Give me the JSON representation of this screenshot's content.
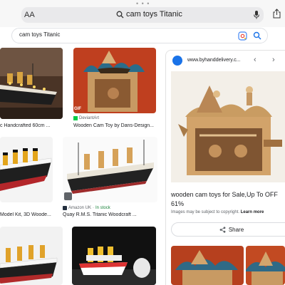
{
  "browser": {
    "aa_label": "AA",
    "address_text": "cam toys Titanic"
  },
  "search": {
    "query": "cam toys Titanic"
  },
  "results": [
    {
      "caption": "c Handcrafted 60cm ..."
    },
    {
      "caption": "Wooden Cam Toy by Dans-Design...",
      "source": "DeviantArt",
      "badge": "GIF"
    },
    {
      "caption": "Model Kit, 3D Woode..."
    },
    {
      "caption": "Quay R.M.S. Titanic Woodcraft ...",
      "source": "Amazon UK",
      "stock": "In stock"
    }
  ],
  "panel": {
    "site_url": "www.byhanddelivery.c...",
    "title": "wooden cam toys for Sale,Up To OFF 61%",
    "note": "Images may be subject to copyright.",
    "learn_more": "Learn more",
    "share_label": "Share"
  },
  "colors": {
    "link_blue": "#1a73e8",
    "in_stock_green": "#188038"
  }
}
